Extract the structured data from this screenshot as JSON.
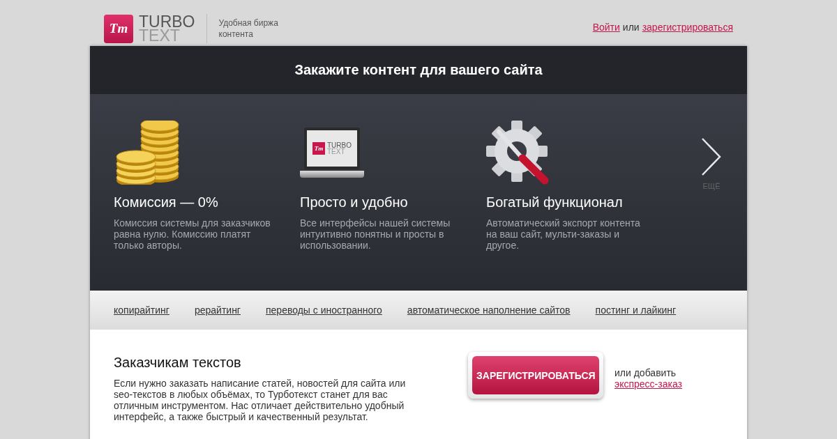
{
  "header": {
    "logo": {
      "mark": "Tт",
      "word_1": "TURBO",
      "word_2": "TEXT"
    },
    "tagline": "Удобная биржа контента",
    "auth": {
      "login": "Войти",
      "separator": "или",
      "register": "зарегистрироваться"
    }
  },
  "hero": {
    "title": "Закажите контент для вашего сайта",
    "features": [
      {
        "kind": "coins",
        "title": "Комиссия — 0%",
        "text": "Комиссия системы для заказчиков равна нулю. Комиссию платят только авторы."
      },
      {
        "kind": "laptop",
        "title": "Просто и удобно",
        "text": "Все интерфейсы нашей системы интуитивно понятны и просты в использовании.",
        "screen": {
          "mark": "Tт",
          "word_1": "TURBO",
          "word_2": "TEXT"
        }
      },
      {
        "kind": "tools",
        "title": "Богатый функционал",
        "text": "Автоматический экспорт контента на ваш сайт, мульти-заказы и другое."
      }
    ],
    "more": "ЕЩЁ"
  },
  "nav": [
    "копирайтинг",
    "рерайтинг",
    "переводы с иностранного",
    "автоматическое наполнение сайтов",
    "постинг и лайкинг"
  ],
  "customers": {
    "title": "Заказчикам текстов",
    "text": "Если нужно заказать написание статей, новостей для сайта или seo-текстов в любых объёмах, то Турботекст станет для вас отличным инструментом. Нас отличает действительно удобный интерфейс, а также быстрый и качественный результат.",
    "button": "ЗАРЕГИСТРИРОВАТЬСЯ",
    "alt_text": "или добавить",
    "alt_link": "экспресс-заказ"
  }
}
